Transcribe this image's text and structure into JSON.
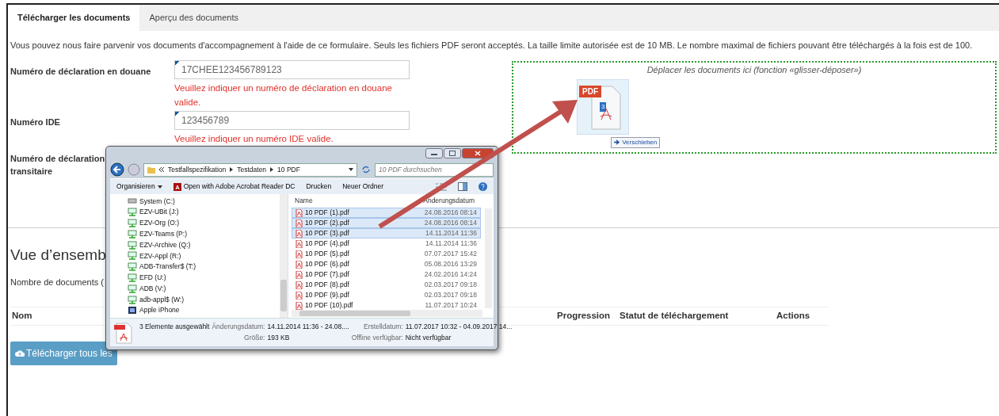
{
  "tabs": [
    {
      "label": "Télécharger les documents",
      "selected": true
    },
    {
      "label": "Aperçu des documents",
      "selected": false
    }
  ],
  "intro": "Vous pouvez nous faire parvenir vos documents d'accompagnement à l'aide de ce formulaire. Seuls les fichiers PDF seront acceptés. La taille limite autorisée est de 10 MB. Le nombre maximal de fichiers pouvant être téléchargés à la fois est de 100.",
  "fields": [
    {
      "label_lines": [
        "Numéro de déclaration en douane"
      ],
      "value": "17CHEE123456789123",
      "error": "Veuillez indiquer un numéro de déclaration en douane valide."
    },
    {
      "label_lines": [
        "Numéro IDE"
      ],
      "value": "123456789",
      "error": "Veuillez indiquer un numéro IDE valide."
    },
    {
      "label_lines": [
        "Numéro de déclaration",
        "transitaire"
      ]
    }
  ],
  "dropzone": {
    "title": "Déplacer les documents ici (fonction «glisser-déposer»)",
    "ghost_label": "PDF",
    "ghost_count": "3",
    "tooltip": "Verschieben"
  },
  "overview": {
    "heading": "Vue d’ensemb",
    "count_text": "Nombre de documents (",
    "columns": [
      "Nom",
      "Progression",
      "Statut de téléchargement",
      "Actions"
    ],
    "button": "Télécharger tous les"
  },
  "explorer": {
    "breadcrumb": [
      "Testfallspezifikation",
      "Testdaten",
      "10 PDF"
    ],
    "search_placeholder": "10 PDF durchsuchen",
    "toolbar": [
      {
        "label": "Organisieren",
        "kind": "menu"
      },
      {
        "label": "Open with Adobe Acrobat Reader DC",
        "kind": "app"
      },
      {
        "label": "Drucken",
        "kind": "plain"
      },
      {
        "label": "Neuer Ordner",
        "kind": "plain"
      }
    ],
    "nav_items": [
      {
        "label": "System (C:)",
        "kind": "system"
      },
      {
        "label": "EZV-UBit (J:)",
        "kind": "network"
      },
      {
        "label": "EZV-Org (O:)",
        "kind": "network"
      },
      {
        "label": "EZV-Teams (P:)",
        "kind": "network"
      },
      {
        "label": "EZV-Archive (Q:)",
        "kind": "network"
      },
      {
        "label": "EZV-Appl (R:)",
        "kind": "network"
      },
      {
        "label": "ADB-Transfer$ (T:)",
        "kind": "network"
      },
      {
        "label": "EFD (U:)",
        "kind": "network"
      },
      {
        "label": "ADB (V:)",
        "kind": "network"
      },
      {
        "label": "adb-appl$ (W:)",
        "kind": "network"
      },
      {
        "label": "Apple iPhone",
        "kind": "device"
      }
    ],
    "columns": [
      "Name",
      "Änderungsdatum"
    ],
    "files": [
      {
        "name": "10 PDF (1).pdf",
        "date": "24.08.2016 08:14",
        "selected": true
      },
      {
        "name": "10 PDF (2).pdf",
        "date": "24.08.2016 08:14",
        "selected": true
      },
      {
        "name": "10 PDF (3).pdf",
        "date": "14.11.2014 11:36",
        "selected": true
      },
      {
        "name": "10 PDF (4).pdf",
        "date": "14.11.2014 11:36",
        "selected": false
      },
      {
        "name": "10 PDF (5).pdf",
        "date": "07.07.2017 15:42",
        "selected": false
      },
      {
        "name": "10 PDF (6).pdf",
        "date": "05.08.2016 13:29",
        "selected": false
      },
      {
        "name": "10 PDF (7).pdf",
        "date": "24.02.2016 14:24",
        "selected": false
      },
      {
        "name": "10 PDF (8).pdf",
        "date": "02.03.2017 09:18",
        "selected": false
      },
      {
        "name": "10 PDF (9).pdf",
        "date": "02.03.2017 09:18",
        "selected": false
      },
      {
        "name": "10 PDF (10).pdf",
        "date": "11.07.2017 10:24",
        "selected": false
      }
    ],
    "details": {
      "summary": "3 Elemente ausgewählt",
      "fields": [
        {
          "label": "Änderungsdatum:",
          "value": "14.11.2014 11:36 - 24.08...."
        },
        {
          "label": "Erstelldatum:",
          "value": "11.07.2017 10:32 - 04.09.2017 14..."
        },
        {
          "label": "Größe:",
          "value": "193 KB"
        },
        {
          "label": "Offline verfügbar:",
          "value": "Nicht verfügbar"
        }
      ]
    }
  }
}
